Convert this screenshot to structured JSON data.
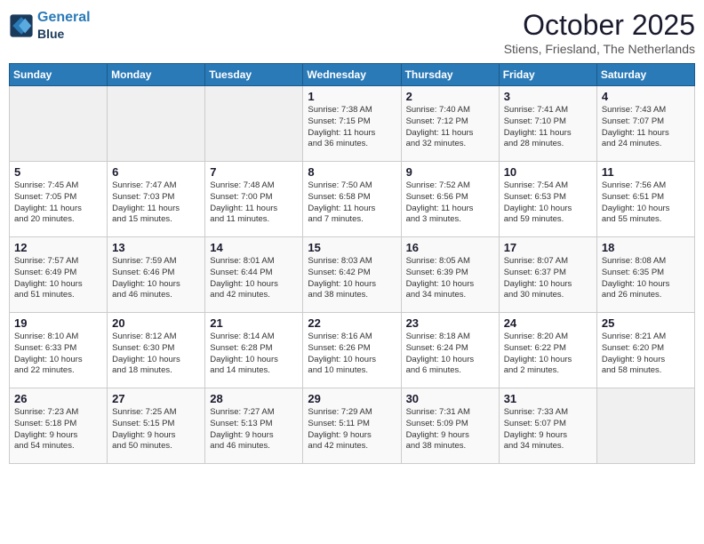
{
  "logo": {
    "line1": "General",
    "line2": "Blue"
  },
  "title": "October 2025",
  "location": "Stiens, Friesland, The Netherlands",
  "headers": [
    "Sunday",
    "Monday",
    "Tuesday",
    "Wednesday",
    "Thursday",
    "Friday",
    "Saturday"
  ],
  "weeks": [
    [
      {
        "day": "",
        "info": ""
      },
      {
        "day": "",
        "info": ""
      },
      {
        "day": "",
        "info": ""
      },
      {
        "day": "1",
        "info": "Sunrise: 7:38 AM\nSunset: 7:15 PM\nDaylight: 11 hours\nand 36 minutes."
      },
      {
        "day": "2",
        "info": "Sunrise: 7:40 AM\nSunset: 7:12 PM\nDaylight: 11 hours\nand 32 minutes."
      },
      {
        "day": "3",
        "info": "Sunrise: 7:41 AM\nSunset: 7:10 PM\nDaylight: 11 hours\nand 28 minutes."
      },
      {
        "day": "4",
        "info": "Sunrise: 7:43 AM\nSunset: 7:07 PM\nDaylight: 11 hours\nand 24 minutes."
      }
    ],
    [
      {
        "day": "5",
        "info": "Sunrise: 7:45 AM\nSunset: 7:05 PM\nDaylight: 11 hours\nand 20 minutes."
      },
      {
        "day": "6",
        "info": "Sunrise: 7:47 AM\nSunset: 7:03 PM\nDaylight: 11 hours\nand 15 minutes."
      },
      {
        "day": "7",
        "info": "Sunrise: 7:48 AM\nSunset: 7:00 PM\nDaylight: 11 hours\nand 11 minutes."
      },
      {
        "day": "8",
        "info": "Sunrise: 7:50 AM\nSunset: 6:58 PM\nDaylight: 11 hours\nand 7 minutes."
      },
      {
        "day": "9",
        "info": "Sunrise: 7:52 AM\nSunset: 6:56 PM\nDaylight: 11 hours\nand 3 minutes."
      },
      {
        "day": "10",
        "info": "Sunrise: 7:54 AM\nSunset: 6:53 PM\nDaylight: 10 hours\nand 59 minutes."
      },
      {
        "day": "11",
        "info": "Sunrise: 7:56 AM\nSunset: 6:51 PM\nDaylight: 10 hours\nand 55 minutes."
      }
    ],
    [
      {
        "day": "12",
        "info": "Sunrise: 7:57 AM\nSunset: 6:49 PM\nDaylight: 10 hours\nand 51 minutes."
      },
      {
        "day": "13",
        "info": "Sunrise: 7:59 AM\nSunset: 6:46 PM\nDaylight: 10 hours\nand 46 minutes."
      },
      {
        "day": "14",
        "info": "Sunrise: 8:01 AM\nSunset: 6:44 PM\nDaylight: 10 hours\nand 42 minutes."
      },
      {
        "day": "15",
        "info": "Sunrise: 8:03 AM\nSunset: 6:42 PM\nDaylight: 10 hours\nand 38 minutes."
      },
      {
        "day": "16",
        "info": "Sunrise: 8:05 AM\nSunset: 6:39 PM\nDaylight: 10 hours\nand 34 minutes."
      },
      {
        "day": "17",
        "info": "Sunrise: 8:07 AM\nSunset: 6:37 PM\nDaylight: 10 hours\nand 30 minutes."
      },
      {
        "day": "18",
        "info": "Sunrise: 8:08 AM\nSunset: 6:35 PM\nDaylight: 10 hours\nand 26 minutes."
      }
    ],
    [
      {
        "day": "19",
        "info": "Sunrise: 8:10 AM\nSunset: 6:33 PM\nDaylight: 10 hours\nand 22 minutes."
      },
      {
        "day": "20",
        "info": "Sunrise: 8:12 AM\nSunset: 6:30 PM\nDaylight: 10 hours\nand 18 minutes."
      },
      {
        "day": "21",
        "info": "Sunrise: 8:14 AM\nSunset: 6:28 PM\nDaylight: 10 hours\nand 14 minutes."
      },
      {
        "day": "22",
        "info": "Sunrise: 8:16 AM\nSunset: 6:26 PM\nDaylight: 10 hours\nand 10 minutes."
      },
      {
        "day": "23",
        "info": "Sunrise: 8:18 AM\nSunset: 6:24 PM\nDaylight: 10 hours\nand 6 minutes."
      },
      {
        "day": "24",
        "info": "Sunrise: 8:20 AM\nSunset: 6:22 PM\nDaylight: 10 hours\nand 2 minutes."
      },
      {
        "day": "25",
        "info": "Sunrise: 8:21 AM\nSunset: 6:20 PM\nDaylight: 9 hours\nand 58 minutes."
      }
    ],
    [
      {
        "day": "26",
        "info": "Sunrise: 7:23 AM\nSunset: 5:18 PM\nDaylight: 9 hours\nand 54 minutes."
      },
      {
        "day": "27",
        "info": "Sunrise: 7:25 AM\nSunset: 5:15 PM\nDaylight: 9 hours\nand 50 minutes."
      },
      {
        "day": "28",
        "info": "Sunrise: 7:27 AM\nSunset: 5:13 PM\nDaylight: 9 hours\nand 46 minutes."
      },
      {
        "day": "29",
        "info": "Sunrise: 7:29 AM\nSunset: 5:11 PM\nDaylight: 9 hours\nand 42 minutes."
      },
      {
        "day": "30",
        "info": "Sunrise: 7:31 AM\nSunset: 5:09 PM\nDaylight: 9 hours\nand 38 minutes."
      },
      {
        "day": "31",
        "info": "Sunrise: 7:33 AM\nSunset: 5:07 PM\nDaylight: 9 hours\nand 34 minutes."
      },
      {
        "day": "",
        "info": ""
      }
    ]
  ]
}
